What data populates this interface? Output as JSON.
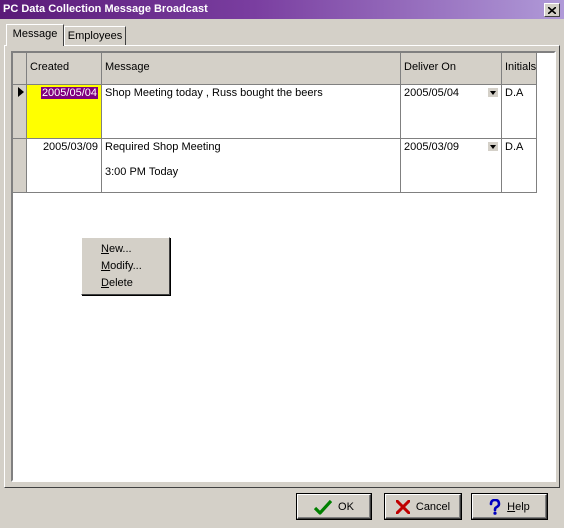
{
  "window": {
    "title": "PC Data Collection Message Broadcast"
  },
  "tabs": [
    {
      "label": "Message",
      "active": true
    },
    {
      "label": "Employees",
      "active": false
    }
  ],
  "grid": {
    "columns": [
      "Created",
      "Message",
      "Deliver On",
      "Initials"
    ],
    "rows": [
      {
        "created": "2005/05/04",
        "message_lines": [
          "Shop Meeting today , Russ bought the beers"
        ],
        "deliver_on": "2005/05/04",
        "initials": "D.A",
        "current": true
      },
      {
        "created": "2005/03/09",
        "message_lines": [
          "Required Shop Meeting",
          "3:00 PM Today"
        ],
        "deliver_on": "2005/03/09",
        "initials": "D.A",
        "current": false
      }
    ]
  },
  "context_menu": {
    "items": [
      {
        "label": "New...",
        "mnemonic": "N"
      },
      {
        "label": "Modify...",
        "mnemonic": "M"
      },
      {
        "label": "Delete",
        "mnemonic": "D"
      }
    ]
  },
  "buttons": {
    "ok": {
      "label": "OK",
      "icon": "check-icon",
      "color": "#008000"
    },
    "cancel": {
      "label": "Cancel",
      "icon": "x-icon",
      "color": "#c00000"
    },
    "help": {
      "label": "Help",
      "icon": "question-icon",
      "color": "#0000c0"
    }
  }
}
